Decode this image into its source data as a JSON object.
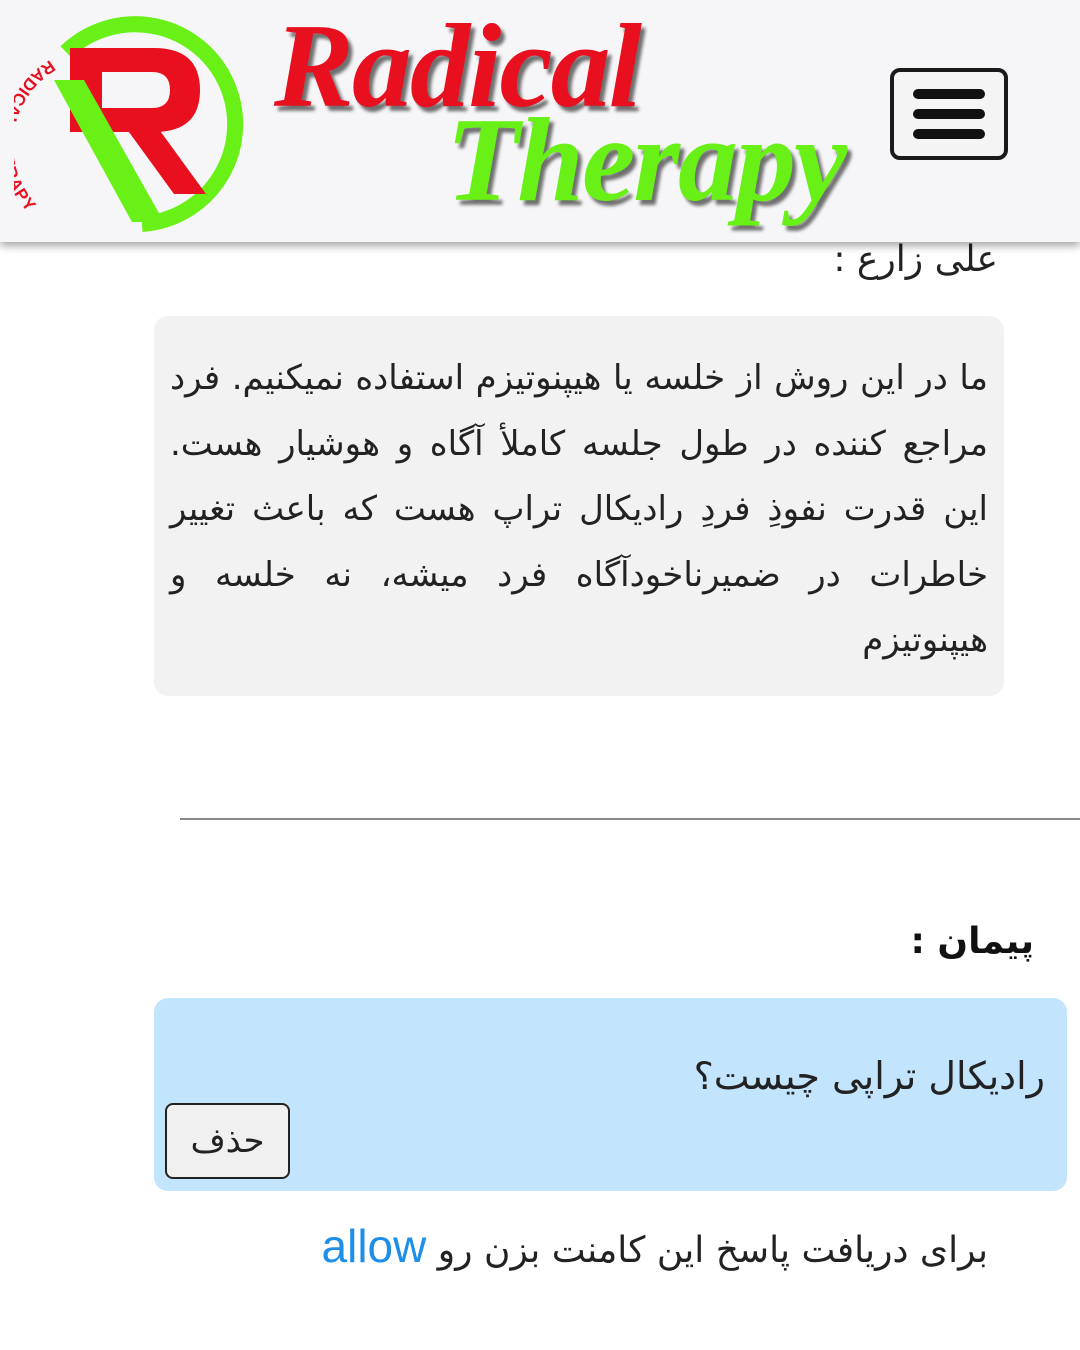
{
  "header": {
    "logo_text": "RADICAL THERAPY",
    "logo_letter": "R",
    "brand_line1": "Radical",
    "brand_line2": "Therapy",
    "menu_icon": "hamburger-icon"
  },
  "comments": [
    {
      "author": "علی زارع :",
      "text": "ما در این روش از خلسه یا هیپنوتیزم استفاده نمیکنیم. فرد مراجع کننده در طول جلسه کاملأ آگاه و هوشیار هست. این قدرت نفوذِ فردِ رادیکال تراپ هست که باعث تغییر خاطرات در ضمیرناخودآگاه فرد میشه، نه خلسه و هیپنوتیزم"
    },
    {
      "author": "پیمان :",
      "text": "رادیکال تراپی چیست؟",
      "delete_label": "حذف"
    }
  ],
  "allow_prompt": {
    "text_before": "برای دریافت پاسخ این کامنت بزن رو",
    "link_label": "allow"
  },
  "colors": {
    "brand_red": "#e8101f",
    "brand_green": "#68f017",
    "question_bg": "#c2e4fc",
    "answer_bg": "#f2f2f2",
    "link_blue": "#1e8fe8"
  }
}
